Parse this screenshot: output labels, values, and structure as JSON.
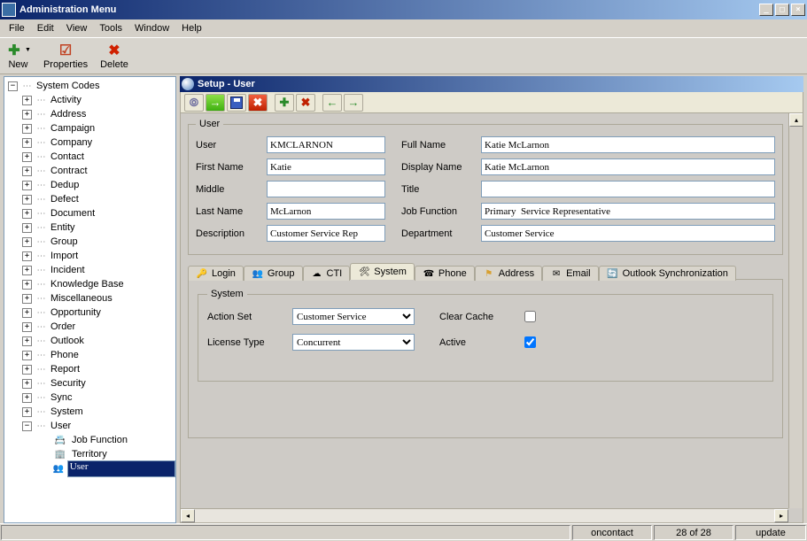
{
  "window": {
    "title": "Administration Menu"
  },
  "menubar": [
    "File",
    "Edit",
    "View",
    "Tools",
    "Window",
    "Help"
  ],
  "toolbar": [
    {
      "label": "New",
      "icon": "+",
      "color": "#2a8a2a",
      "drop": true
    },
    {
      "label": "Properties",
      "icon": "☑",
      "color": "#c04020",
      "drop": false
    },
    {
      "label": "Delete",
      "icon": "✖",
      "color": "#d02000",
      "drop": false
    }
  ],
  "tree": {
    "root": "System Codes",
    "items": [
      "Activity",
      "Address",
      "Campaign",
      "Company",
      "Contact",
      "Contract",
      "Dedup",
      "Defect",
      "Document",
      "Entity",
      "Group",
      "Import",
      "Incident",
      "Knowledge Base",
      "Miscellaneous",
      "Opportunity",
      "Order",
      "Outlook",
      "Phone",
      "Report",
      "Security",
      "Sync",
      "System"
    ],
    "user_node": "User",
    "user_children": [
      "Job Function",
      "Territory",
      "User"
    ],
    "selected": "User"
  },
  "setup": {
    "title": "Setup - User",
    "user_group": "User",
    "fields": {
      "user_lbl": "User",
      "user_val": "KMCLARNON",
      "first_lbl": "First Name",
      "first_val": "Katie",
      "middle_lbl": "Middle",
      "middle_val": "",
      "last_lbl": "Last Name",
      "last_val": "McLarnon",
      "desc_lbl": "Description",
      "desc_val": "Customer Service Rep",
      "full_lbl": "Full Name",
      "full_val": "Katie McLarnon",
      "disp_lbl": "Display Name",
      "disp_val": "Katie McLarnon",
      "title_lbl": "Title",
      "title_val": "",
      "job_lbl": "Job Function",
      "job_val": "Primary  Service Representative",
      "dept_lbl": "Department",
      "dept_val": "Customer Service"
    },
    "tabs": [
      "Login",
      "Group",
      "CTI",
      "System",
      "Phone",
      "Address",
      "Email",
      "Outlook Synchronization"
    ],
    "active_tab": "System",
    "system": {
      "legend": "System",
      "action_lbl": "Action Set",
      "action_val": "Customer Service",
      "lic_lbl": "License Type",
      "lic_val": "Concurrent",
      "clear_lbl": "Clear Cache",
      "clear_val": false,
      "active_lbl": "Active",
      "active_val": true
    }
  },
  "status": {
    "s1": "oncontact",
    "s2": "28 of 28",
    "s3": "update"
  }
}
